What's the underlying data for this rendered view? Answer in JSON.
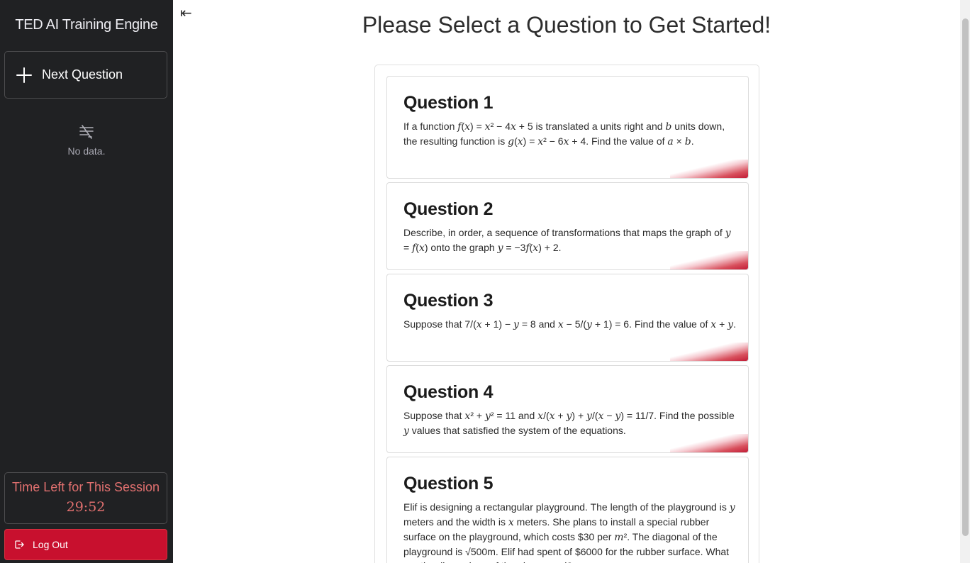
{
  "sidebar": {
    "app_title": "TED AI Training Engine",
    "next_button": "Next Question",
    "nodata_icon": "no-data-icon",
    "nodata_text": "No data.",
    "timer_label": "Time Left for This Session",
    "timer_value": "29:52",
    "logout_label": "Log Out"
  },
  "main": {
    "collapse_icon": "⇤",
    "page_title": "Please Select a Question to Get Started!",
    "questions": [
      {
        "title": "Question 1"
      },
      {
        "title": "Question 2"
      },
      {
        "title": "Question 3"
      },
      {
        "title": "Question 4"
      },
      {
        "title": "Question 5"
      }
    ]
  },
  "colors": {
    "sidebar_bg": "#202123",
    "accent_red": "#c8102e",
    "timer_text": "#e1706f"
  }
}
